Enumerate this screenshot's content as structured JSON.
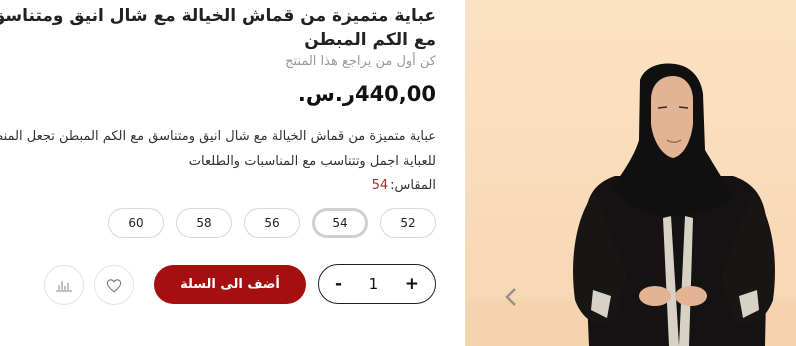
{
  "product": {
    "title": "عباية متميزة من قماش الخيالة مع شال انيق ومتناسق مع الكم المبطن",
    "review_prompt": "كن أول من يراجع هذا المنتج",
    "price": "440,00ر.س.",
    "description": "عباية متميزة من قماش الخيالة مع شال انيق ومتناسق مع الكم المبطن تجعل المنظر للعباية اجمل وتتناسب مع المناسبات والطلعات",
    "size_label": "المقاس:",
    "selected_size": "54",
    "sizes": [
      "52",
      "54",
      "56",
      "58",
      "60"
    ]
  },
  "cart": {
    "quantity": "1",
    "minus": "-",
    "plus": "+",
    "add_to_cart": "أضف الى السلة"
  },
  "icons": {
    "wishlist": "heart-icon",
    "compare": "compare-icon",
    "prev": "chevron-left-icon"
  },
  "colors": {
    "accent": "#a60f0f",
    "selected_size": "#a0322c",
    "image_background": "#fbe2c3"
  }
}
